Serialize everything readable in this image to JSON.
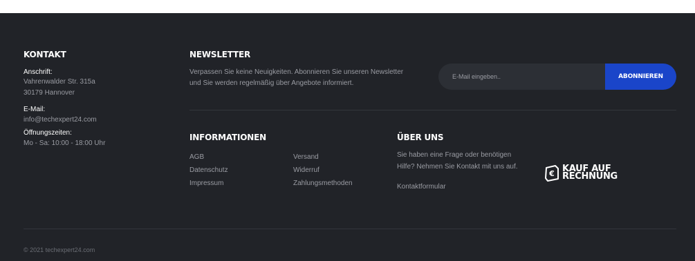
{
  "contact": {
    "heading": "KONTAKT",
    "address_label": "Anschrift:",
    "address_line1": "Vahrenwalder Str. 315a",
    "address_line2": "30179 Hannover",
    "email_label": "E-Mail:",
    "email": "info@techexpert24.com",
    "hours_label": "Öffnungszeiten:",
    "hours": "Mo - Sa: 10:00 - 18:00 Uhr"
  },
  "newsletter": {
    "heading": "NEWSLETTER",
    "text_line1": "Verpassen Sie keine Neuigkeiten. Abonnieren Sie unseren Newsletter",
    "text_line2": "und Sie werden regelmäßig über Angebote informiert.",
    "email_placeholder": "E-Mail eingeben..",
    "subscribe_label": "ABONNIEREN"
  },
  "informationen": {
    "heading": "INFORMATIONEN",
    "links": [
      "AGB",
      "Datenschutz",
      "Impressum",
      "Versand",
      "Widerruf",
      "Zahlungsmethoden"
    ]
  },
  "ueber_uns": {
    "heading": "ÜBER UNS",
    "text_line1": "Sie haben eine Frage oder benötigen",
    "text_line2": "Hilfe? Nehmen Sie Kontakt mit uns auf.",
    "contact_link": "Kontaktformular"
  },
  "badge": {
    "line1": "KAUF AUF",
    "line2": "RECHNUNG",
    "icon": "euro-receipt-icon"
  },
  "copyright": "© 2021 techexpert24.com",
  "colors": {
    "footer_bg": "#212328",
    "accent_button": "#1a45c9",
    "input_bg": "#2c2f35",
    "text_muted": "#9a9ca3",
    "heading": "#ffffff"
  }
}
